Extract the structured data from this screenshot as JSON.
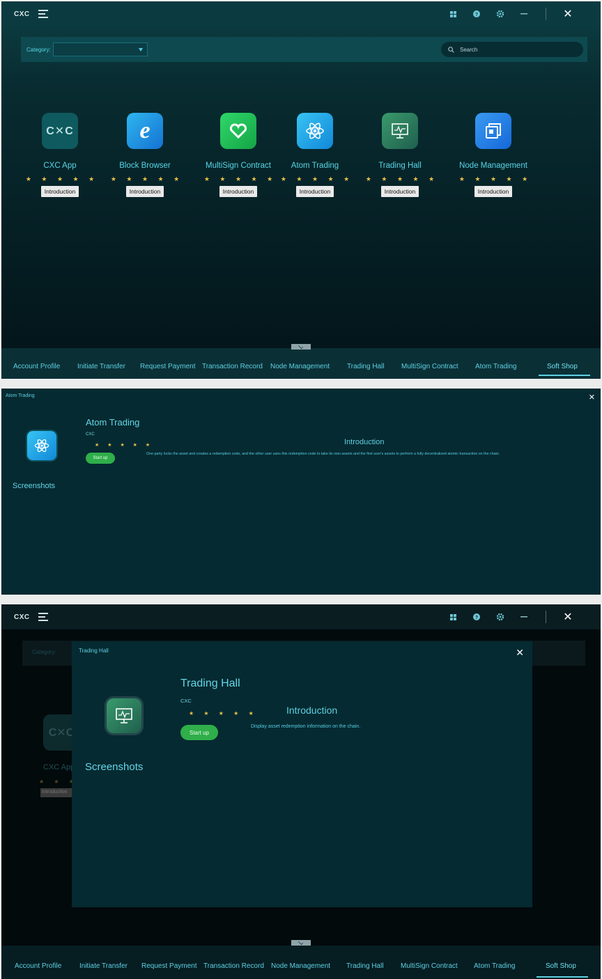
{
  "titlebar": {
    "logo": "CXC",
    "icons": [
      "apps-grid-icon",
      "help-icon",
      "settings-gear-icon",
      "minimize-icon",
      "close-icon"
    ]
  },
  "filter": {
    "category_label": "Category:",
    "category_value": "",
    "search_placeholder": "Search"
  },
  "apps": [
    {
      "name": "CXC App",
      "icon": "cxc-logo-icon",
      "rating": 5,
      "intro_label": "Introduction",
      "color": "#0f5a5e"
    },
    {
      "name": "Block Browser",
      "icon": "browser-e-icon",
      "rating": 5,
      "intro_label": "Introduction",
      "color": "#1b8fd8"
    },
    {
      "name": "MultiSign Contract",
      "icon": "infinity-heart-icon",
      "rating": 5,
      "intro_label": "Introduction",
      "color": "#1fbf58"
    },
    {
      "name": "Atom Trading",
      "icon": "atom-icon",
      "rating": 5,
      "intro_label": "Introduction",
      "color": "#1aa8e6"
    },
    {
      "name": "Trading Hall",
      "icon": "monitor-chart-icon",
      "rating": 5,
      "intro_label": "Introduction",
      "color": "#2e7a5a"
    },
    {
      "name": "Node Management",
      "icon": "window-stack-icon",
      "rating": 5,
      "intro_label": "Introduction",
      "color": "#1e7fe0"
    }
  ],
  "stars": "★ ★ ★ ★ ★",
  "bottom_nav": {
    "items": [
      "Account Profile",
      "Initiate Transfer",
      "Request Payment",
      "Transaction Record",
      "Node Management",
      "Trading Hall",
      "MultiSign Contract",
      "Atom Trading",
      "Soft Shop"
    ],
    "active": "Soft Shop"
  },
  "detail_atom": {
    "window_title": "Atom Trading",
    "app_name": "Atom Trading",
    "vendor": "CXC",
    "start_label": "Start up",
    "intro_heading": "Introduction",
    "intro_text": "One party locks the asset and creates a redemption code, and the other user uses this redemption code to take its own assets and the first user's assets to perform a fully decentralized atomic transaction on the chain.",
    "screenshots_heading": "Screenshots"
  },
  "detail_trading": {
    "window_title": "Trading Hall",
    "app_name": "Trading Hall",
    "vendor": "CXC",
    "start_label": "Start up",
    "intro_heading": "Introduction",
    "intro_text": "Display asset redemption information on the chain.",
    "screenshots_heading": "Screenshots"
  },
  "background_dimmed": {
    "category_label": "Category:",
    "app_name": "CXC App",
    "intro_label": "Introduction"
  },
  "colors": {
    "accent": "#5fd0e2",
    "star": "#e8c24a",
    "start_button": "#2fae4a"
  }
}
